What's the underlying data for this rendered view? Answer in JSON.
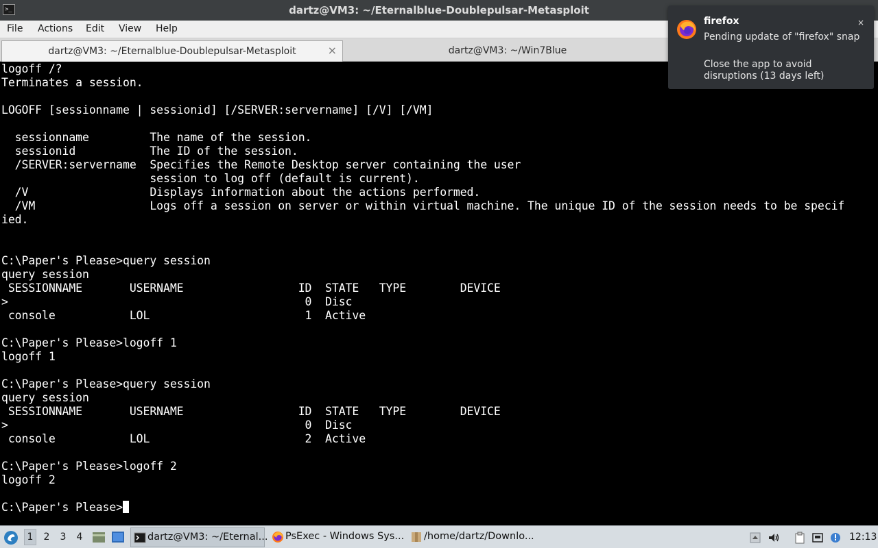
{
  "window": {
    "title": "dartz@VM3: ~/Eternalblue-Doublepulsar-Metasploit"
  },
  "menu": [
    "File",
    "Actions",
    "Edit",
    "View",
    "Help"
  ],
  "tabs": [
    {
      "label": "dartz@VM3: ~/Eternalblue-Doublepulsar-Metasploit",
      "active": true,
      "close": "×"
    },
    {
      "label": "dartz@VM3: ~/Win7Blue",
      "active": false
    }
  ],
  "terminal": {
    "lines": [
      "logoff /?",
      "Terminates a session.",
      "",
      "LOGOFF [sessionname | sessionid] [/SERVER:servername] [/V] [/VM]",
      "",
      "  sessionname         The name of the session.",
      "  sessionid           The ID of the session.",
      "  /SERVER:servername  Specifies the Remote Desktop server containing the user",
      "                      session to log off (default is current).",
      "  /V                  Displays information about the actions performed.",
      "  /VM                 Logs off a session on server or within virtual machine. The unique ID of the session needs to be specif",
      "ied.",
      "",
      "",
      "C:\\Paper's Please>query session",
      "query session",
      " SESSIONNAME       USERNAME                 ID  STATE   TYPE        DEVICE",
      ">                                            0  Disc",
      " console           LOL                       1  Active",
      "",
      "C:\\Paper's Please>logoff 1",
      "logoff 1",
      "",
      "C:\\Paper's Please>query session",
      "query session",
      " SESSIONNAME       USERNAME                 ID  STATE   TYPE        DEVICE",
      ">                                            0  Disc",
      " console           LOL                       2  Active",
      "",
      "C:\\Paper's Please>logoff 2",
      "logoff 2",
      ""
    ],
    "prompt": "C:\\Paper's Please>"
  },
  "notification": {
    "app": "firefox",
    "message": "Pending update of \"firefox\" snap",
    "detail": "Close the app to avoid disruptions (13 days left)",
    "close": "×"
  },
  "taskbar": {
    "workspaces": [
      "1",
      "2",
      "3",
      "4"
    ],
    "active_workspace": "1",
    "tasks": [
      {
        "label": "dartz@VM3: ~/Eternal...",
        "icon": "terminal-icon",
        "active": true
      },
      {
        "label": "PsExec - Windows Sys...",
        "icon": "firefox-icon",
        "active": false
      },
      {
        "label": "/home/dartz/Downlo...",
        "icon": "folder-icon",
        "active": false
      }
    ],
    "clock": "12:13"
  }
}
